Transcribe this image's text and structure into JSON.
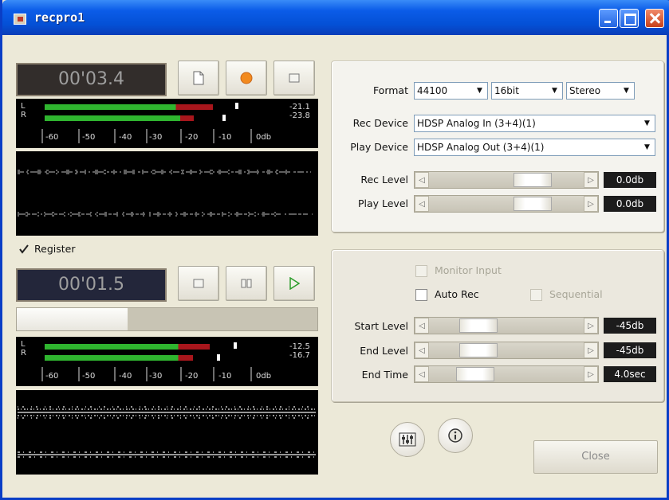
{
  "window": {
    "title": "recpro1"
  },
  "recorder": {
    "time": "00'03.4",
    "meter": {
      "left_db": "-21.1",
      "right_db": "-23.8",
      "ticks": [
        "-60",
        "-50",
        "-40",
        "-30",
        "-20",
        "-10",
        "0db"
      ],
      "left_level": 0.84,
      "right_level": 0.78
    }
  },
  "register_label": "Register",
  "player": {
    "time": "00'01.5",
    "progress": 0.37,
    "meter": {
      "left_db": "-12.5",
      "right_db": "-16.7",
      "ticks": [
        "-60",
        "-50",
        "-40",
        "-30",
        "-20",
        "-10",
        "0db"
      ],
      "left_level": 0.84,
      "right_level": 0.76
    }
  },
  "settings": {
    "format_label": "Format",
    "sample_rate": "44100",
    "bit_depth": "16bit",
    "channels": "Stereo",
    "rec_device_label": "Rec Device",
    "rec_device": "HDSP Analog In (3+4)(1)",
    "play_device_label": "Play Device",
    "play_device": "HDSP Analog Out (3+4)(1)",
    "rec_level_label": "Rec Level",
    "rec_level": "0.0db",
    "play_level_label": "Play Level",
    "play_level": "0.0db"
  },
  "auto": {
    "monitor_input_label": "Monitor Input",
    "auto_rec_label": "Auto Rec",
    "sequential_label": "Sequential",
    "start_level_label": "Start Level",
    "start_level": "-45db",
    "end_level_label": "End Level",
    "end_level": "-45db",
    "end_time_label": "End Time",
    "end_time": "4.0sec"
  },
  "close_label": "Close",
  "colors": {
    "meter_green": "#2fb52f",
    "meter_red": "#a8161c",
    "titlebar": "#0b5ce8"
  }
}
